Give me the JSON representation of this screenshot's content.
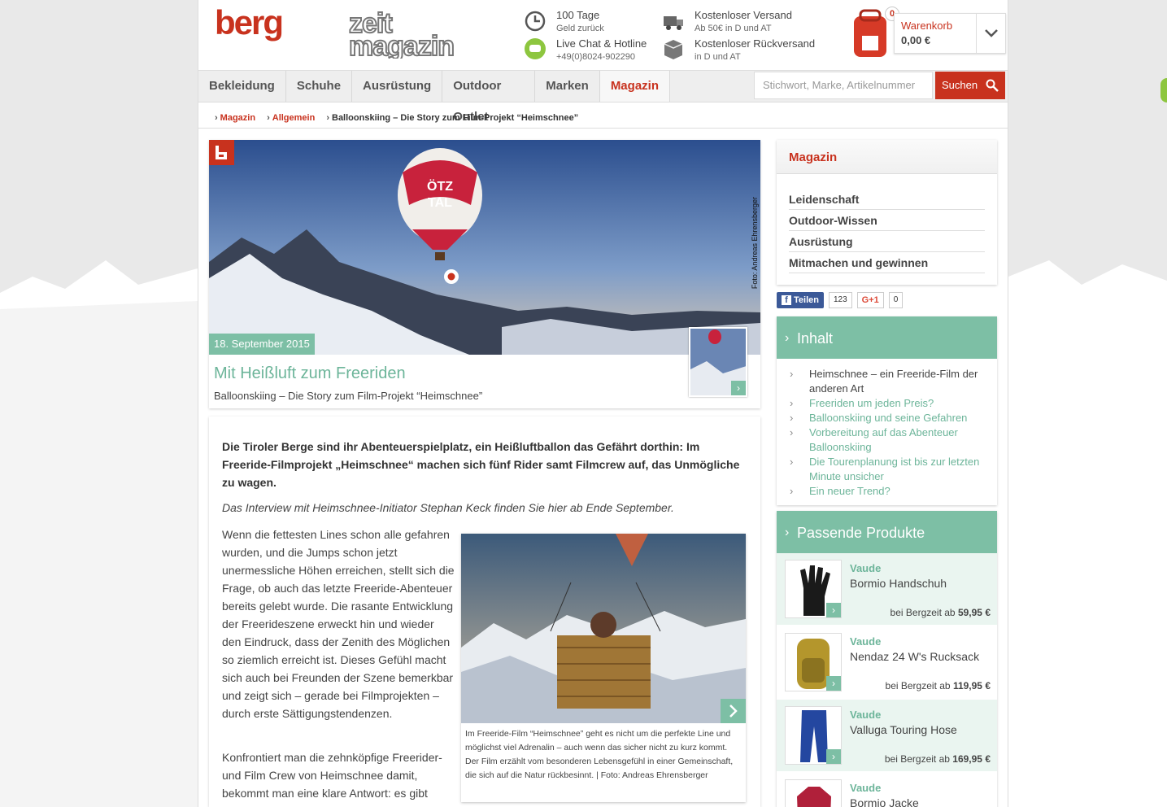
{
  "header": {
    "services": [
      {
        "title": "100 Tage",
        "sub": "Geld zurück",
        "icon": "clock-icon"
      },
      {
        "title": "Live Chat & Hotline",
        "sub": "+49(0)8024-902290",
        "icon": "chat-icon"
      },
      {
        "title": "Kostenloser Versand",
        "sub": "Ab 50€ in D und AT",
        "icon": "truck-icon"
      },
      {
        "title": "Kostenloser Rückversand",
        "sub": "in D und AT",
        "icon": "box-icon"
      }
    ],
    "cart": {
      "label": "Warenkorb",
      "sum": "0,00 €",
      "count": "0"
    }
  },
  "nav": {
    "items": [
      "Bekleidung",
      "Schuhe",
      "Ausrüstung",
      "Outdoor Outlet",
      "Marken",
      "Magazin"
    ]
  },
  "search": {
    "placeholder": "Stichwort, Marke, Artikelnummer",
    "button": "Suchen"
  },
  "breadcrumb": [
    "Magazin",
    "Allgemein",
    "Balloonskiing – Die Story zum Film-Projekt “Heimschnee”"
  ],
  "hero": {
    "date": "18. September 2015",
    "title": "Mit Heißluft zum Freeriden",
    "subtitle": "Balloonskiing – Die Story zum Film-Projekt “Heimschnee”",
    "credit": "Foto: Andreas Ehrensberger",
    "balloon_text_1": "ÖTZ",
    "balloon_text_2": "TAL"
  },
  "article": {
    "lead": "Die Tiroler Berge sind ihr Abenteuerspielplatz, ein Heißluftballon das Gefährt dorthin: Im Freeride-Filmprojekt „Heimschnee“ machen sich fünf Rider samt Filmcrew auf, das Unmögliche zu wagen.",
    "interview": "Das Interview mit Heimschnee-Initiator Stephan Keck finden Sie hier ab Ende September.",
    "p1": "Wenn die fettesten Lines schon alle gefahren wurden, und die Jumps schon jetzt unermessliche Höhen erreichen, stellt sich die Frage, ob auch das letzte Freeride-Abenteuer bereits gelebt wurde. Die rasante Entwicklung der Freerideszene erweckt hin und wieder den Eindruck, dass der Zenith des Möglichen so ziemlich erreicht ist. Dieses Gefühl macht sich auch bei Freunden der Szene bemerkbar und zeigt sich – gerade bei Filmprojekten – durch erste Sättigungstendenzen.",
    "p2": "Konfrontiert man die zehnköpfige Freerider- und Film Crew von Heimschnee damit, bekommt man eine klare Antwort: es gibt",
    "caption": "Im Freeride-Film “Heimschnee” geht es nicht um die perfekte Line und möglichst viel Adrenalin – auch wenn das sicher nicht zu kurz kommt. Der Film erzählt vom besonderen Lebensgefühl in einer Gemeinschaft, die sich auf die Natur rückbesinnt. | Foto: Andreas Ehrensberger"
  },
  "sidebar": {
    "magazin_title": "Magazin",
    "magazin_items": [
      "Leidenschaft",
      "Outdoor-Wissen",
      "Ausrüstung",
      "Mitmachen und gewinnen"
    ],
    "share": {
      "fb": "Teilen",
      "fb_count": "123",
      "gplus": "G+1",
      "gplus_count": "0"
    },
    "toc_title": "Inhalt",
    "toc": [
      "Heimschnee – ein Freeride-Film der anderen Art",
      "Freeriden um jeden Preis?",
      "Balloonskiing und seine Gefahren",
      "Vorbereitung auf das Abenteuer Balloonskiing",
      "Die Tourenplanung ist bis zur letzten Minute unsicher",
      "Ein neuer Trend?"
    ],
    "products_title": "Passende Produkte",
    "products": [
      {
        "brand": "Vaude",
        "name": "Bormio Handschuh",
        "price_prefix": "bei Bergzeit ab",
        "price": "59,95 €"
      },
      {
        "brand": "Vaude",
        "name": "Nendaz 24 W's Rucksack",
        "price_prefix": "bei Bergzeit ab",
        "price": "119,95 €"
      },
      {
        "brand": "Vaude",
        "name": "Valluga Touring Hose",
        "price_prefix": "bei Bergzeit ab",
        "price": "169,95 €"
      },
      {
        "brand": "Vaude",
        "name": "Bormio Jacke",
        "price_prefix": "",
        "price": ""
      }
    ]
  },
  "colors": {
    "brand_red": "#c8321e",
    "accent_green": "#7dbfa5"
  }
}
